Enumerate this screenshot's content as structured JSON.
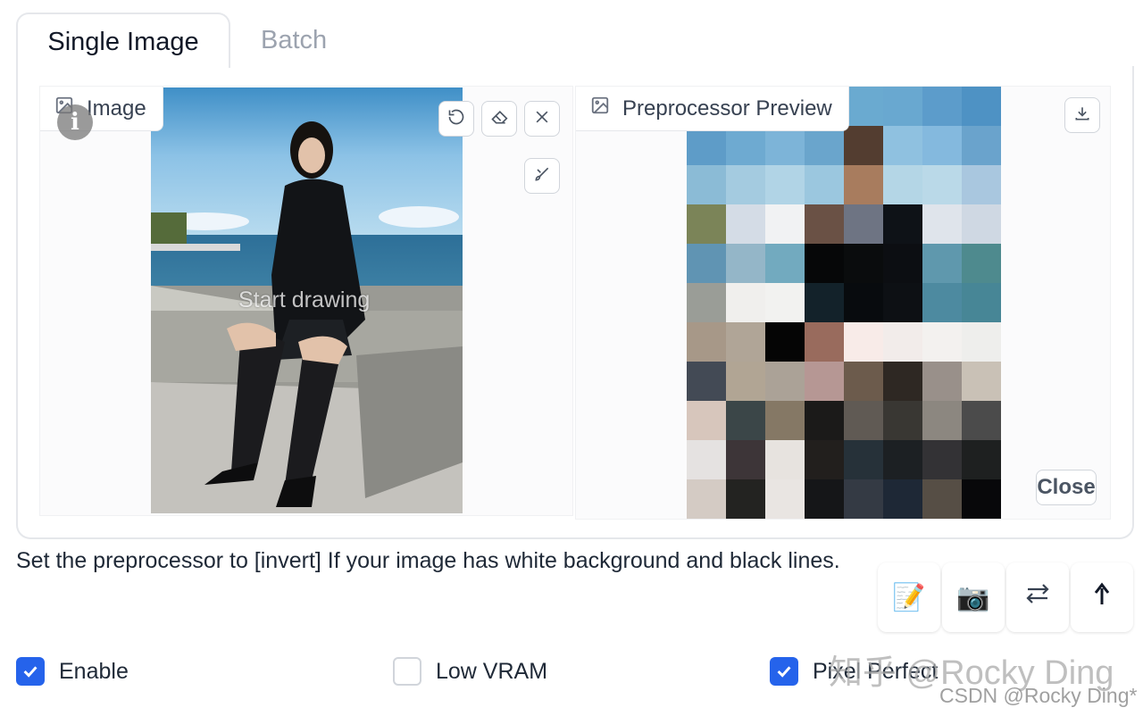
{
  "tabs": {
    "active": "Single Image",
    "inactive": "Batch"
  },
  "left_block": {
    "label": "Image",
    "overlay_text": "Start drawing",
    "info_glyph": "i",
    "icons": {
      "label": "image-icon",
      "undo": "undo-icon",
      "erase": "eraser-icon",
      "clear": "close-icon",
      "brush": "brush-icon"
    }
  },
  "right_block": {
    "label": "Preprocessor Preview",
    "close_label": "Close",
    "icons": {
      "label": "image-icon",
      "download": "download-icon"
    },
    "mosaic_colors": [
      [
        "#ffffff",
        "#ffffff",
        "#ffffff",
        "#ffffff",
        "#6aaad0",
        "#69a8d0",
        "#5c9ccb",
        "#4e92c4"
      ],
      [
        "#5e9cc8",
        "#6eaad1",
        "#7db4d8",
        "#6aa5cc",
        "#533d30",
        "#8fc1e0",
        "#84b9de",
        "#6aa3cc"
      ],
      [
        "#8bbbd6",
        "#a4cbe0",
        "#b1d4e6",
        "#9bc7df",
        "#a87c5e",
        "#b4d6e6",
        "#bad9e8",
        "#a9c7df"
      ],
      [
        "#7b8458",
        "#d4dce6",
        "#f1f2f3",
        "#6a5145",
        "#6e7483",
        "#0e1217",
        "#dfe4eb",
        "#cfd8e3"
      ],
      [
        "#6094b3",
        "#94b6c8",
        "#72aabf",
        "#060708",
        "#0a0c0d",
        "#0c0e12",
        "#5f98ad",
        "#4e8a8e"
      ],
      [
        "#9a9d97",
        "#f0efed",
        "#f2f2f0",
        "#13222a",
        "#080b0e",
        "#0d1014",
        "#4d8aa0",
        "#478696"
      ],
      [
        "#a79888",
        "#b0a597",
        "#050505",
        "#996b5d",
        "#f8ebe8",
        "#f2ecea",
        "#f3f1ef",
        "#eeeeec"
      ],
      [
        "#434a55",
        "#b1a594",
        "#aba297",
        "#b69794",
        "#6c5b4c",
        "#2e2823",
        "#99908a",
        "#c9c1b6"
      ],
      [
        "#d7c6bc",
        "#3b4648",
        "#857865",
        "#1b1a19",
        "#605a54",
        "#393733",
        "#8c8780",
        "#4b4b4b"
      ],
      [
        "#e5e2e1",
        "#3d3538",
        "#e7e3df",
        "#221f1d",
        "#263139",
        "#1c2023",
        "#333235",
        "#1e2020"
      ],
      [
        "#d4cbc4",
        "#232321",
        "#e9e5e2",
        "#151618",
        "#343a44",
        "#1e2836",
        "#564e45",
        "#08080a"
      ]
    ]
  },
  "hint_text": "Set the preprocessor to [invert] If your image has white background and black lines.",
  "actions": [
    {
      "name": "edit-action-button",
      "glyph": "📝"
    },
    {
      "name": "camera-action-button",
      "glyph": "📷"
    },
    {
      "name": "swap-action-button",
      "icon": "swap-icon"
    },
    {
      "name": "send-up-action-button",
      "icon": "arrow-up-icon"
    }
  ],
  "options": [
    {
      "label": "Enable",
      "checked": true
    },
    {
      "label": "Low VRAM",
      "checked": false
    },
    {
      "label": "Pixel Perfect",
      "checked": true
    }
  ],
  "watermark": {
    "main": "知乎 @Rocky Ding",
    "csdn": "CSDN @Rocky Ding*"
  },
  "colors": {
    "accent": "#2563eb",
    "border": "#e5e7eb"
  }
}
